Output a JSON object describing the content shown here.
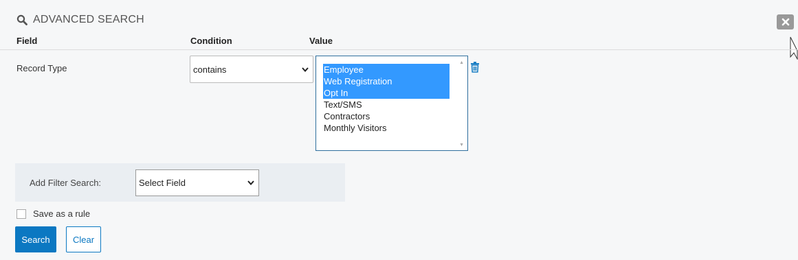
{
  "panel": {
    "title": "ADVANCED SEARCH",
    "icons": {
      "search": "search-icon",
      "close": "close-icon"
    }
  },
  "columns": {
    "field": "Field",
    "condition": "Condition",
    "value": "Value"
  },
  "filter_row": {
    "field_label": "Record Type",
    "condition_value": "contains",
    "value_options": [
      {
        "label": "Employee",
        "selected": true
      },
      {
        "label": "Web Registration",
        "selected": true
      },
      {
        "label": "Opt In",
        "selected": true
      },
      {
        "label": "Text/SMS",
        "selected": false
      },
      {
        "label": "Contractors",
        "selected": false
      },
      {
        "label": "Monthly Visitors",
        "selected": false
      }
    ]
  },
  "add_filter": {
    "label": "Add Filter Search:",
    "select_value": "Select Field"
  },
  "save_rule": {
    "label": "Save as a rule",
    "checked": false
  },
  "actions": {
    "search_label": "Search",
    "clear_label": "Clear"
  },
  "colors": {
    "accent": "#0b78c2",
    "selection": "#3399ff",
    "panel_bg": "#f6f7f8",
    "filter_bg": "#eaeef2"
  }
}
